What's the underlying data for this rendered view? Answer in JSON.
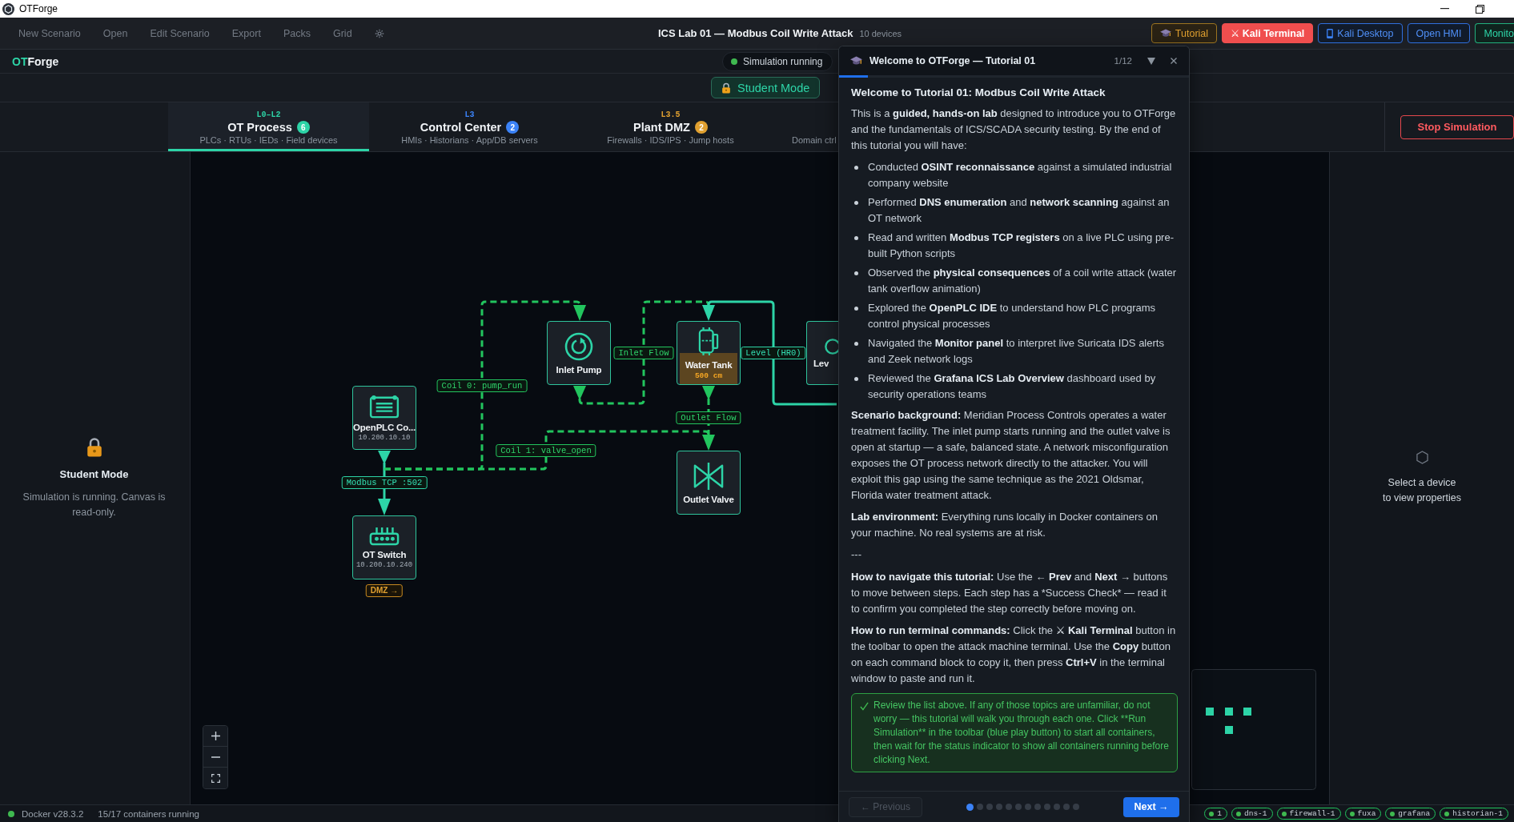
{
  "window": {
    "title": "OTForge"
  },
  "menu": [
    "New Scenario",
    "Open",
    "Edit Scenario",
    "Export",
    "Packs",
    "Grid"
  ],
  "scenario": {
    "title": "ICS Lab 01 — Modbus Coil Write Attack",
    "devices": "10 devices"
  },
  "toolbar": [
    {
      "label": "Tutorial",
      "kind": "tutorial"
    },
    {
      "label": "⚔ Kali Terminal",
      "kind": "terminal"
    },
    {
      "label": "Kali Desktop",
      "kind": "desktop"
    },
    {
      "label": "Open HMI",
      "kind": "hmi"
    },
    {
      "label": "Monito",
      "kind": "monitor"
    }
  ],
  "logo": {
    "accent": "OT",
    "text": "Forge"
  },
  "simulation_status": {
    "label": "Simulation running",
    "running": true
  },
  "mode_button": {
    "label": "Student Mode"
  },
  "tabs": [
    {
      "level": "L0–L2",
      "title": "OT Process",
      "count": "6",
      "subtitle": "PLCs · RTUs · IEDs · Field devices",
      "color": "#2dd4a7",
      "selected": true
    },
    {
      "level": "L3",
      "title": "Control Center",
      "count": "2",
      "subtitle": "HMIs · Historians · App/DB servers",
      "color": "#3b82f6",
      "selected": false
    },
    {
      "level": "L3.5",
      "title": "Plant DMZ",
      "count": "2",
      "subtitle": "Firewalls · IDS/IPS · Jump hosts",
      "color": "#e0a030",
      "selected": false
    },
    {
      "subtitle": "Domain ctrl",
      "selected": false
    }
  ],
  "stop_button": {
    "label": "Stop Simulation"
  },
  "left_panel": {
    "title": "Student Mode",
    "message": "Simulation is running. Canvas is read-only."
  },
  "canvas": {
    "nodes": [
      {
        "label": "OpenPLC Co...",
        "address": "10.200.10.10",
        "kind": "plc"
      },
      {
        "label": "OT Switch",
        "address": "10.200.10.240",
        "kind": "switch",
        "badge": "DMZ →"
      },
      {
        "label": "Inlet Pump",
        "kind": "pump"
      },
      {
        "label": "Water Tank",
        "reading": "500 cm",
        "level": 0.5,
        "kind": "tank"
      },
      {
        "label": "Outlet Valve",
        "kind": "valve"
      },
      {
        "label": "Lev",
        "kind": "sensor"
      }
    ],
    "edges": [
      {
        "label": "Modbus TCP :502",
        "kind": "network"
      },
      {
        "label": "Coil 0: pump_run",
        "kind": "control"
      },
      {
        "label": "Coil 1: valve_open",
        "kind": "control"
      },
      {
        "label": "Inlet Flow",
        "kind": "process"
      },
      {
        "label": "Level (HR0)",
        "kind": "telemetry"
      },
      {
        "label": "Outlet Flow",
        "kind": "process"
      }
    ]
  },
  "right_panel": {
    "message": "Select a device\nto view properties"
  },
  "tutorial": {
    "title": "Welcome to OTForge — Tutorial 01",
    "step": "1/12",
    "level": 0.083,
    "blocks": [
      {
        "kind": "heading",
        "text": "Welcome to Tutorial 01: Modbus Coil Write Attack"
      },
      {
        "kind": "paragraph",
        "runs": [
          {
            "text": "This is a ",
            "bold": false
          },
          {
            "text": "guided, hands-on lab",
            "bold": true
          },
          {
            "text": " designed to introduce you to OTForge and the fundamentals of ICS/SCADA security testing. By the end of this tutorial you will have:",
            "bold": false
          }
        ]
      },
      {
        "kind": "list",
        "items": [
          {
            "runs": [
              {
                "text": "Conducted ",
                "bold": false
              },
              {
                "text": "OSINT reconnaissance",
                "bold": true
              },
              {
                "text": " against a simulated industrial company website",
                "bold": false
              }
            ]
          },
          {
            "runs": [
              {
                "text": "Performed ",
                "bold": false
              },
              {
                "text": "DNS enumeration",
                "bold": true
              },
              {
                "text": " and ",
                "bold": false
              },
              {
                "text": "network scanning",
                "bold": true
              },
              {
                "text": " against an OT network",
                "bold": false
              }
            ]
          },
          {
            "runs": [
              {
                "text": "Read and written ",
                "bold": false
              },
              {
                "text": "Modbus TCP registers",
                "bold": true
              },
              {
                "text": " on a live PLC using pre-built Python scripts",
                "bold": false
              }
            ]
          },
          {
            "runs": [
              {
                "text": "Observed the ",
                "bold": false
              },
              {
                "text": "physical consequences",
                "bold": true
              },
              {
                "text": " of a coil write attack (water tank overflow animation)",
                "bold": false
              }
            ]
          },
          {
            "runs": [
              {
                "text": "Explored the ",
                "bold": false
              },
              {
                "text": "OpenPLC IDE",
                "bold": true
              },
              {
                "text": " to understand how PLC programs control physical processes",
                "bold": false
              }
            ]
          },
          {
            "runs": [
              {
                "text": "Navigated the ",
                "bold": false
              },
              {
                "text": "Monitor panel",
                "bold": true
              },
              {
                "text": " to interpret live Suricata IDS alerts and Zeek network logs",
                "bold": false
              }
            ]
          },
          {
            "runs": [
              {
                "text": "Reviewed the ",
                "bold": false
              },
              {
                "text": "Grafana ICS Lab Overview",
                "bold": true
              },
              {
                "text": " dashboard used by security operations teams",
                "bold": false
              }
            ]
          }
        ]
      },
      {
        "kind": "paragraph",
        "runs": [
          {
            "text": "Scenario background:",
            "bold": true
          },
          {
            "text": " Meridian Process Controls operates a water treatment facility. The inlet pump starts running and the outlet valve is open at startup — a safe, balanced state. A network misconfiguration exposes the OT process network directly to the attacker. You will exploit this gap using the same technique as the 2021 Oldsmar, Florida water treatment attack.",
            "bold": false
          }
        ]
      },
      {
        "kind": "paragraph",
        "runs": [
          {
            "text": "Lab environment:",
            "bold": true
          },
          {
            "text": " Everything runs locally in Docker containers on your machine. No real systems are at risk.",
            "bold": false
          }
        ]
      },
      {
        "kind": "rule",
        "text": "---"
      },
      {
        "kind": "paragraph",
        "runs": [
          {
            "text": "How to navigate this tutorial:",
            "bold": true
          },
          {
            "text": " Use the ← ",
            "bold": false
          },
          {
            "text": "Prev",
            "bold": true
          },
          {
            "text": " and ",
            "bold": false
          },
          {
            "text": "Next",
            "bold": true
          },
          {
            "text": " → buttons to move between steps. Each step has a *Success Check* — read it to confirm you completed the step correctly before moving on.",
            "bold": false
          }
        ]
      },
      {
        "kind": "paragraph",
        "runs": [
          {
            "text": "How to run terminal commands:",
            "bold": true
          },
          {
            "text": " Click the ",
            "bold": false
          },
          {
            "text": "⚔ Kali Terminal",
            "bold": true
          },
          {
            "text": " button in the toolbar to open the attack machine terminal. Use the ",
            "bold": false
          },
          {
            "text": "Copy",
            "bold": true
          },
          {
            "text": " button on each command block to copy it, then press ",
            "bold": false
          },
          {
            "text": "Ctrl+V",
            "bold": true
          },
          {
            "text": " in the terminal window to paste and run it.",
            "bold": false
          }
        ]
      },
      {
        "kind": "callout",
        "text": "Review the list above. If any of those topics are unfamiliar, do not worry — this tutorial will walk you through each one. Click **Run Simulation** in the toolbar (blue play button) to start all containers, then wait for the status indicator to show all containers running before clicking Next."
      }
    ],
    "previous": {
      "label": "← Previous",
      "disabled": true
    },
    "steps": [
      {
        "selected": true
      },
      {
        "selected": false
      },
      {
        "selected": false
      },
      {
        "selected": false
      },
      {
        "selected": false
      },
      {
        "selected": false
      },
      {
        "selected": false
      },
      {
        "selected": false
      },
      {
        "selected": false
      },
      {
        "selected": false
      },
      {
        "selected": false
      },
      {
        "selected": false
      }
    ],
    "next": {
      "label": "Next →"
    }
  },
  "status_bar": {
    "running": true,
    "docker": "Docker v28.3.2",
    "containers": "15/17 containers running",
    "chips": [
      "1",
      "dns-1",
      "firewall-1",
      "fuxa",
      "grafana",
      "historian-1"
    ]
  }
}
